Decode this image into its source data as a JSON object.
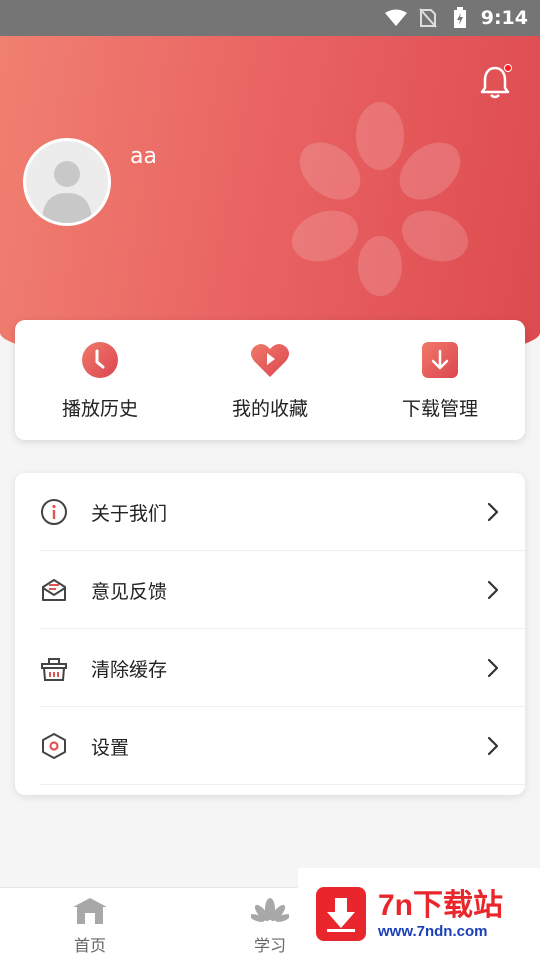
{
  "status_bar": {
    "time": "9:14",
    "icons": [
      "wifi-icon",
      "no-sim-icon",
      "battery-charging-icon"
    ]
  },
  "profile": {
    "username": "aa",
    "has_notification": true
  },
  "quick_actions": [
    {
      "label": "播放历史",
      "icon": "clock-icon"
    },
    {
      "label": "我的收藏",
      "icon": "heart-play-icon"
    },
    {
      "label": "下载管理",
      "icon": "download-icon"
    }
  ],
  "menu": [
    {
      "label": "关于我们",
      "icon": "info-icon"
    },
    {
      "label": "意见反馈",
      "icon": "feedback-mail-icon"
    },
    {
      "label": "清除缓存",
      "icon": "clear-cache-basket-icon"
    },
    {
      "label": "设置",
      "icon": "settings-hexagon-icon"
    }
  ],
  "bottom_nav": [
    {
      "label": "首页",
      "icon": "home-icon"
    },
    {
      "label": "学习",
      "icon": "lotus-icon"
    }
  ],
  "watermark": {
    "title": "7n下载站",
    "url": "www.7ndn.com"
  },
  "colors": {
    "accent": "#e05555",
    "header_start": "#f08070",
    "header_end": "#dd4a4f"
  }
}
